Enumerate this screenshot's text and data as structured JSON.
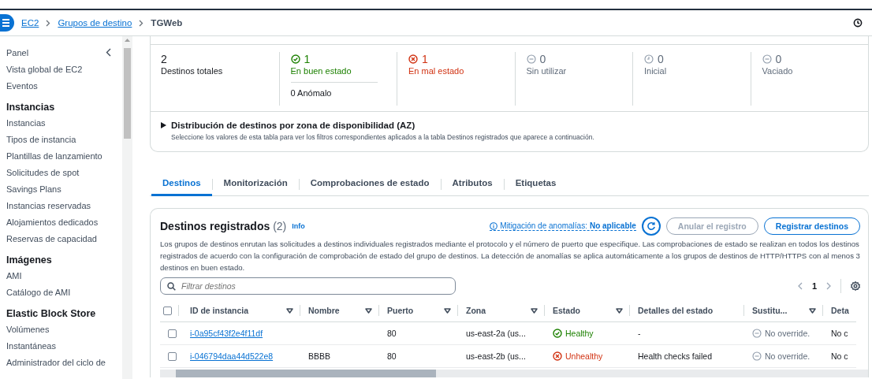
{
  "breadcrumb": [
    {
      "label": "EC2",
      "link": true
    },
    {
      "label": "Grupos de destino",
      "link": true
    },
    {
      "label": "TGWeb",
      "link": false
    }
  ],
  "sidebar": {
    "items": [
      {
        "label": "Panel",
        "kind": "item"
      },
      {
        "label": "Vista global de EC2",
        "kind": "item"
      },
      {
        "label": "Eventos",
        "kind": "item"
      },
      {
        "label": "Instancias",
        "kind": "heading"
      },
      {
        "label": "Instancias",
        "kind": "item"
      },
      {
        "label": "Tipos de instancia",
        "kind": "item"
      },
      {
        "label": "Plantillas de lanzamiento",
        "kind": "item"
      },
      {
        "label": "Solicitudes de spot",
        "kind": "item"
      },
      {
        "label": "Savings Plans",
        "kind": "item"
      },
      {
        "label": "Instancias reservadas",
        "kind": "item"
      },
      {
        "label": "Alojamientos dedicados",
        "kind": "item"
      },
      {
        "label": "Reservas de capacidad",
        "kind": "item"
      },
      {
        "label": "Imágenes",
        "kind": "heading"
      },
      {
        "label": "AMI",
        "kind": "item"
      },
      {
        "label": "Catálogo de AMI",
        "kind": "item"
      },
      {
        "label": "Elastic Block Store",
        "kind": "heading"
      },
      {
        "label": "Volúmenes",
        "kind": "item"
      },
      {
        "label": "Instantáneas",
        "kind": "item"
      },
      {
        "label": "Administrador del ciclo de",
        "kind": "item"
      }
    ]
  },
  "summary": {
    "stats": [
      {
        "kind": "total",
        "value": "2",
        "label": "Destinos totales"
      },
      {
        "kind": "healthy",
        "value": "1",
        "label": "En buen estado",
        "sub": "0 Anómalo"
      },
      {
        "kind": "unhealthy",
        "value": "1",
        "label": "En mal estado"
      },
      {
        "kind": "unused",
        "value": "0",
        "label": "Sin utilizar"
      },
      {
        "kind": "initial",
        "value": "0",
        "label": "Inicial"
      },
      {
        "kind": "draining",
        "value": "0",
        "label": "Vaciado"
      }
    ],
    "az_title": "Distribución de destinos por zona de disponibilidad (AZ)",
    "expanded": false,
    "az_hint": "Seleccione los valores de esta tabla para ver los filtros correspondientes aplicados a la tabla Destinos registrados que aparece a continuación."
  },
  "tabs": [
    {
      "label": "Destinos",
      "selected": true
    },
    {
      "label": "Monitorización",
      "selected": false
    },
    {
      "label": "Comprobaciones de estado",
      "selected": false
    },
    {
      "label": "Atributos",
      "selected": false
    },
    {
      "label": "Etiquetas",
      "selected": false
    }
  ],
  "targets": {
    "title": "Destinos registrados",
    "count": "(2)",
    "info": "Info",
    "mitigation": "Mitigación de anomalías:**No aplicable**",
    "deregister": "Anular el registro",
    "register": "Registrar destinos",
    "description": "Los grupos de destinos enrutan las solicitudes a destinos individuales registrados mediante el protocolo y el número de puerto que especifique. Las comprobaciones de estado se realizan en todos los destinos registrados de acuerdo con la configuración de comprobación de estado del grupo de destinos. La detección de anomalías se aplica automáticamente a los grupos de destinos de HTTP/HTTPS con al menos 3 destinos en buen estado.",
    "search": {
      "placeholder": "Filtrar destinos"
    },
    "page": "1",
    "select_all_checked": false,
    "columns": [
      {
        "label": "ID de instancia",
        "sortable": true
      },
      {
        "label": "Nombre",
        "sortable": true
      },
      {
        "label": "Puerto",
        "sortable": true
      },
      {
        "label": "Zona",
        "sortable": true
      },
      {
        "label": "Estado",
        "sortable": true
      },
      {
        "label": "Detalles del estado",
        "sortable": false
      },
      {
        "label": "Sustitu...",
        "sortable": true
      },
      {
        "label": "Deta",
        "sortable": false
      }
    ],
    "rows": [
      {
        "checked": false,
        "id": "i-0a95cf43f2e4f11df",
        "port": "80",
        "zone": "us-east-2a (us...",
        "status": "Healthy",
        "healthy": true,
        "details": "-",
        "override": "No override.",
        "column_8": "No c"
      },
      {
        "checked": false,
        "id": "i-046794daa44d522e8",
        "name": "BBBB",
        "port": "80",
        "zone": "us-east-2b (us...",
        "status": "Unhealthy",
        "healthy": false,
        "details": "Health checks failed",
        "override": "No override.",
        "column_8": "No c"
      }
    ]
  }
}
